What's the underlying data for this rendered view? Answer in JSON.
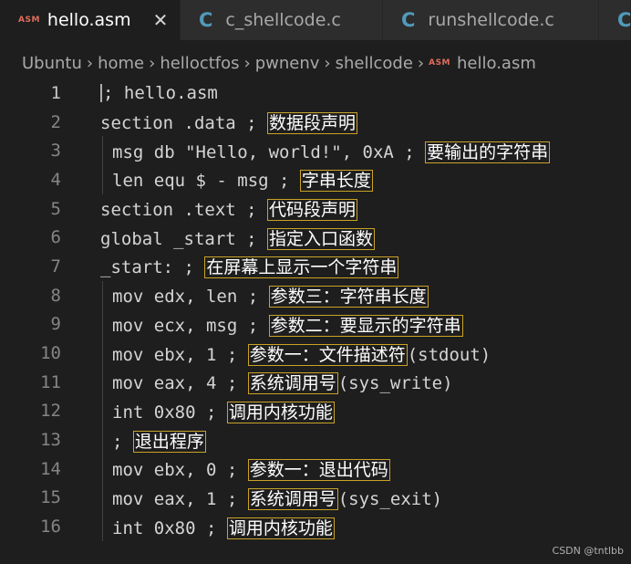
{
  "tabs": [
    {
      "badge": "ASM",
      "label": "hello.asm",
      "close": "✕"
    },
    {
      "badge": "C",
      "label": "c_shellcode.c"
    },
    {
      "badge": "C",
      "label": "runshellcode.c"
    },
    {
      "badge": "C",
      "label": ""
    }
  ],
  "breadcrumb": {
    "items": [
      "Ubuntu",
      "home",
      "helloctfos",
      "pwnenv",
      "shellcode"
    ],
    "file_badge": "ASM",
    "file": "hello.asm",
    "separator": "›"
  },
  "lines": [
    {
      "n": "1",
      "code": "; hello.asm",
      "comment": ""
    },
    {
      "n": "2",
      "code": "section .data ; ",
      "comment": "数据段声明",
      "tail": ""
    },
    {
      "n": "3",
      "code": "msg db \"Hello, world!\", 0xA ; ",
      "comment": "要输出的字符串",
      "tail": ""
    },
    {
      "n": "4",
      "code": "len equ $ - msg ; ",
      "comment": "字串长度",
      "tail": ""
    },
    {
      "n": "5",
      "code": "section .text ; ",
      "comment": "代码段声明",
      "tail": ""
    },
    {
      "n": "6",
      "code": "global _start ; ",
      "comment": "指定入口函数",
      "tail": ""
    },
    {
      "n": "7",
      "code": "_start: ; ",
      "comment": "在屏幕上显示一个字符串",
      "tail": ""
    },
    {
      "n": "8",
      "code": "mov edx, len ; ",
      "comment": "参数三：字符串长度",
      "tail": ""
    },
    {
      "n": "9",
      "code": "mov ecx, msg ; ",
      "comment": "参数二：要显示的字符串",
      "tail": ""
    },
    {
      "n": "10",
      "code": "mov ebx, 1 ; ",
      "comment": "参数一：文件描述符",
      "tail": "(stdout)"
    },
    {
      "n": "11",
      "code": "mov eax, 4 ; ",
      "comment": "系统调用号",
      "tail": "(sys_write)"
    },
    {
      "n": "12",
      "code": "int 0x80 ; ",
      "comment": "调用内核功能",
      "tail": ""
    },
    {
      "n": "13",
      "code": "; ",
      "comment": "退出程序",
      "tail": ""
    },
    {
      "n": "14",
      "code": "mov ebx, 0 ; ",
      "comment": "参数一：退出代码",
      "tail": ""
    },
    {
      "n": "15",
      "code": "mov eax, 1 ; ",
      "comment": "系统调用号",
      "tail": "(sys_exit)"
    },
    {
      "n": "16",
      "code": "int 0x80 ; ",
      "comment": "调用内核功能",
      "tail": ""
    }
  ],
  "watermark": "CSDN @tntlbb",
  "colors": {
    "background": "#1e1e1e",
    "comment_box": "#c9a227",
    "asm_badge": "#e06c5a",
    "c_badge": "#519aba"
  }
}
